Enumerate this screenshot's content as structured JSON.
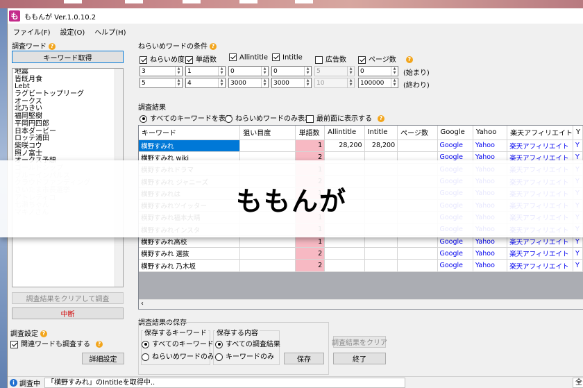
{
  "window": {
    "title": "ももんが Ver.1.0.10.2",
    "icon_char": "も"
  },
  "menu": [
    "ファイル(F)",
    "設定(O)",
    "ヘルプ(H)"
  ],
  "left": {
    "section_label": "調査ワード",
    "get_keywords_button": "キーワード取得",
    "keywords": [
      "地震",
      "皆既月食",
      "Lebt",
      "ラグビートップリーグ",
      "オークス",
      "北乃きい",
      "福岡堅樹",
      "平岡円四郎",
      "日本ダービー",
      "ロッテ浦田",
      "柴咲コウ",
      "照ノ富士",
      "オークス予想",
      "ゴールドシップ",
      "ブルーインパルス",
      "クラウドファンディング",
      "さいたま市長選挙",
      "アトレティコ",
      "七瀬ちゃん",
      "マキノさん"
    ],
    "faded_from": 13,
    "clear_and_search_button": "調査結果をクリアして調査",
    "stop_button": "中断",
    "settings_label": "調査設定",
    "related_words_checkbox": {
      "label": "関連ワードも調査する",
      "checked": true
    },
    "detail_settings_button": "詳細設定"
  },
  "conditions": {
    "label": "ねらいめワードの条件",
    "checks": [
      {
        "label": "ねらいめ度",
        "checked": true
      },
      {
        "label": "単語数",
        "checked": true
      },
      {
        "label": "Allintitle",
        "checked": true
      },
      {
        "label": "Intitle",
        "checked": true
      },
      {
        "label": "広告数",
        "checked": false
      },
      {
        "label": "ページ数",
        "checked": true
      }
    ],
    "start_values": [
      "3",
      "1",
      "0",
      "0",
      "5",
      "0"
    ],
    "end_values": [
      "5",
      "4",
      "3000",
      "3000",
      "10",
      "100000"
    ],
    "start_label": "(始まり)",
    "end_label": "(終わり)"
  },
  "results": {
    "label": "調査結果",
    "radio_all": "すべてのキーワードを表示",
    "radio_target": "ねらいめワードのみ表示",
    "front_checkbox": "最前面に表示する",
    "columns": [
      "キーワード",
      "狙い目度",
      "単語数",
      "Allintitle",
      "Intitle",
      "ページ数",
      "Google",
      "Yahoo",
      "楽天アフィリエイト",
      "Y"
    ],
    "rows": [
      {
        "kw": "横野すみれ",
        "aim": "",
        "words": "1",
        "allintitle": "28,200",
        "intitle": "28,200",
        "pages": "",
        "google": "Google",
        "yahoo": "Yahoo",
        "rakuten": "楽天アフィリエイト",
        "y": "Y"
      },
      {
        "kw": "横野すみれ wiki",
        "aim": "",
        "words": "2",
        "allintitle": "",
        "intitle": "",
        "pages": "",
        "google": "Google",
        "yahoo": "Yahoo",
        "rakuten": "楽天アフィリエイト",
        "y": "Y"
      },
      {
        "kw": "横野すみれドラマ",
        "aim": "",
        "words": "1",
        "allintitle": "",
        "intitle": "",
        "pages": "",
        "google": "Google",
        "yahoo": "Yahoo",
        "rakuten": "楽天アフィリエイト",
        "y": "Y"
      },
      {
        "kw": "横野すみれ ジャニーズ",
        "aim": "",
        "words": "2",
        "allintitle": "",
        "intitle": "",
        "pages": "",
        "google": "Google",
        "yahoo": "Yahoo",
        "rakuten": "楽天アフィリエイト",
        "y": "Y"
      },
      {
        "kw": "横野すみれは",
        "aim": "",
        "words": "1",
        "allintitle": "",
        "intitle": "",
        "pages": "",
        "google": "Google",
        "yahoo": "Yahoo",
        "rakuten": "楽天アフィリエイト",
        "y": "Y"
      },
      {
        "kw": "横野すみれツイッター",
        "aim": "",
        "words": "1",
        "allintitle": "",
        "intitle": "",
        "pages": "",
        "google": "Google",
        "yahoo": "Yahoo",
        "rakuten": "楽天アフィリエイト",
        "y": "Y"
      },
      {
        "kw": "横野すみれ福本大晴",
        "aim": "",
        "words": "1",
        "allintitle": "",
        "intitle": "",
        "pages": "",
        "google": "Google",
        "yahoo": "Yahoo",
        "rakuten": "楽天アフィリエイト",
        "y": "Y"
      },
      {
        "kw": "横野すみれインスタ",
        "aim": "",
        "words": "1",
        "allintitle": "",
        "intitle": "",
        "pages": "",
        "google": "Google",
        "yahoo": "Yahoo",
        "rakuten": "楽天アフィリエイト",
        "y": "Y"
      },
      {
        "kw": "横野すみれ高校",
        "aim": "",
        "words": "1",
        "allintitle": "",
        "intitle": "",
        "pages": "",
        "google": "Google",
        "yahoo": "Yahoo",
        "rakuten": "楽天アフィリエイト",
        "y": "Y"
      },
      {
        "kw": "横野すみれ 選抜",
        "aim": "",
        "words": "2",
        "allintitle": "",
        "intitle": "",
        "pages": "",
        "google": "Google",
        "yahoo": "Yahoo",
        "rakuten": "楽天アフィリエイト",
        "y": "Y"
      },
      {
        "kw": "横野すみれ 乃木坂",
        "aim": "",
        "words": "2",
        "allintitle": "",
        "intitle": "",
        "pages": "",
        "google": "Google",
        "yahoo": "Yahoo",
        "rakuten": "楽天アフィリエイト",
        "y": "Y"
      }
    ]
  },
  "save": {
    "label": "調査結果の保存",
    "keywords_group": "保存するキーワード",
    "kw_all": "すべてのキーワード",
    "kw_target": "ねらいめワードのみ",
    "content_group": "保存する内容",
    "content_all": "すべての調査結果",
    "content_kw": "キーワードのみ",
    "save_button": "保存",
    "clear_button": "調査結果をクリア",
    "exit_button": "終了"
  },
  "status": {
    "state": "調査中",
    "message": "「横野すみれ」のIntitleを取得中..",
    "right": "全"
  },
  "banner": {
    "text": "ももんが"
  },
  "colors": {
    "accent": "#0078d7",
    "pink_cell": "#f7b9c3",
    "link": "#0000ee",
    "stop": "#d00000",
    "app_icon": "#c42a8b"
  }
}
